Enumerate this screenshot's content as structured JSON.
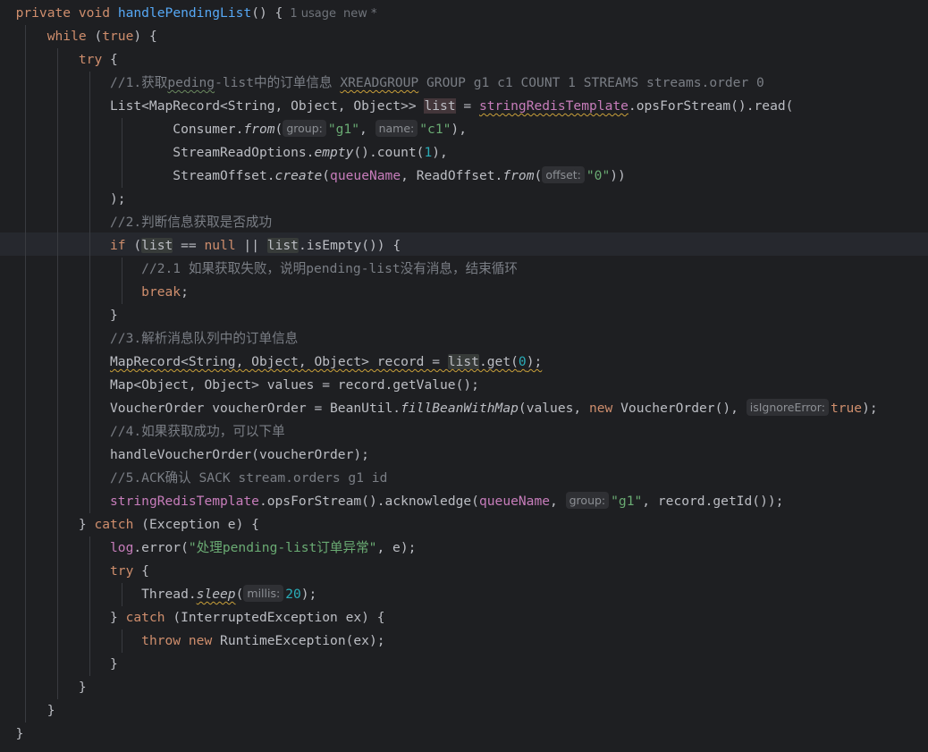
{
  "editor": {
    "usage_hint": "1 usage",
    "author_hint": "new *",
    "comments": {
      "c1_pre": "//1.获取",
      "c1_word": "peding",
      "c1_mid": "-list中的订单信息 ",
      "c1_cmd": "XREADGROUP",
      "c1_post": " GROUP g1 c1 COUNT 1 STREAMS streams.order 0",
      "c2": "//2.判断信息获取是否成功",
      "c21": "//2.1 如果获取失败，说明pending-list没有消息，结束循环",
      "c3": "//3.解析消息队列中的订单信息",
      "c4": "//4.如果获取成功，可以下单",
      "c5": "//5.ACK确认 SACK stream.orders g1 id"
    },
    "strings": {
      "g1": "\"g1\"",
      "c1": "\"c1\"",
      "zero": "\"0\"",
      "error_msg": "\"处理pending-list订单异常\""
    },
    "numbers": {
      "one": "1",
      "zero": "0",
      "twenty": "20"
    },
    "hints": {
      "group": "group:",
      "name": "name:",
      "offset": "offset:",
      "is_ignore_error": "isIgnoreError:",
      "millis": "millis:"
    }
  }
}
